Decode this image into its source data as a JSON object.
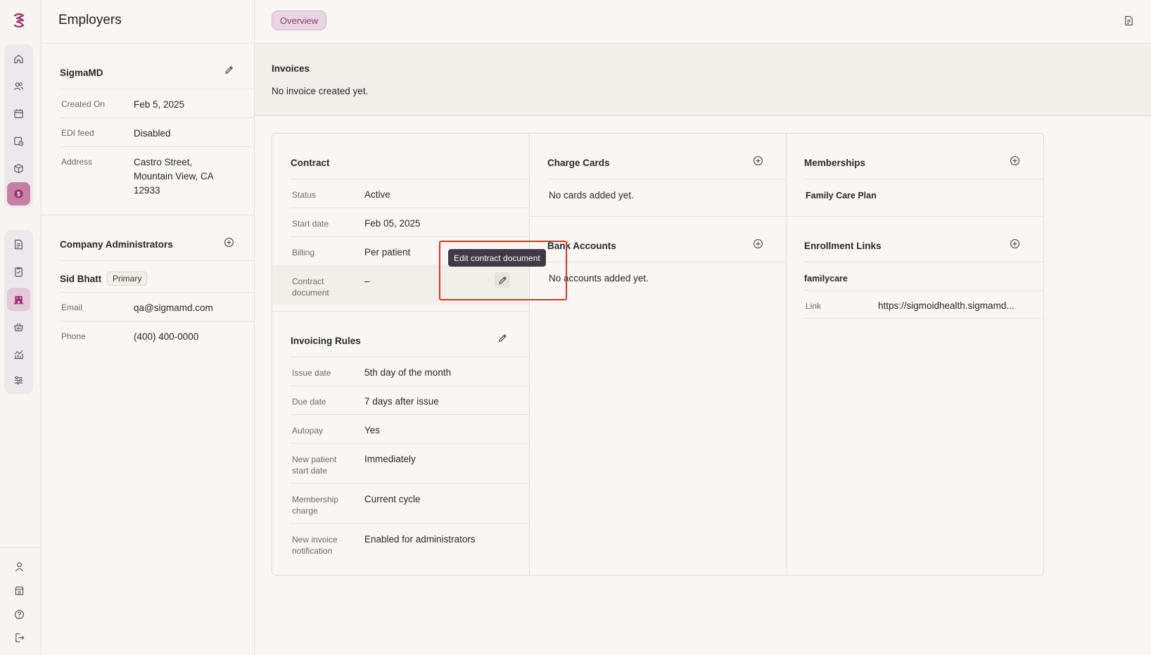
{
  "app": {
    "page_title": "Employers"
  },
  "nav": {
    "top_icons": [
      "home-icon",
      "patients-icon",
      "calendar-icon",
      "tasks-icon",
      "inventory-icon",
      "billing-icon"
    ],
    "secondary_icons": [
      "documents-icon",
      "reports-icon",
      "employers-icon",
      "store-icon",
      "analytics-icon",
      "settings-icon"
    ],
    "bottom_icons": [
      "profile-icon",
      "clinic-icon",
      "help-icon",
      "logout-icon"
    ]
  },
  "employer": {
    "name": "SigmaMD",
    "created_on_label": "Created On",
    "created_on": "Feb 5, 2025",
    "edi_label": "EDI feed",
    "edi_value": "Disabled",
    "address_label": "Address",
    "address_line1": "Castro Street,",
    "address_line2": "Mountain View, CA",
    "address_line3": "12933"
  },
  "administrators": {
    "title": "Company Administrators",
    "name": "Sid Bhatt",
    "badge": "Primary",
    "email_label": "Email",
    "email": "qa@sigmamd.com",
    "phone_label": "Phone",
    "phone": "(400) 400-0000"
  },
  "tabs": {
    "overview": "Overview"
  },
  "invoices": {
    "title": "Invoices",
    "empty": "No invoice created yet."
  },
  "contract": {
    "title": "Contract",
    "status_label": "Status",
    "status": "Active",
    "start_label": "Start date",
    "start": "Feb 05, 2025",
    "billing_label": "Billing",
    "billing": "Per patient",
    "doc_label_1": "Contract",
    "doc_label_2": "document",
    "doc": "–",
    "tooltip": "Edit contract document"
  },
  "invoicing_rules": {
    "title": "Invoicing Rules",
    "issue_label": "Issue date",
    "issue": "5th day of the month",
    "due_label": "Due date",
    "due": "7 days after issue",
    "autopay_label": "Autopay",
    "autopay": "Yes",
    "new_patient_label_1": "New patient",
    "new_patient_label_2": "start date",
    "new_patient": "Immediately",
    "membership_label_1": "Membership",
    "membership_label_2": "charge",
    "membership": "Current cycle",
    "notification_label_1": "New invoice",
    "notification_label_2": "notification",
    "notification": "Enabled for administrators"
  },
  "charge_cards": {
    "title": "Charge Cards",
    "empty": "No cards added yet."
  },
  "bank_accounts": {
    "title": "Bank Accounts",
    "empty": "No accounts added yet."
  },
  "memberships": {
    "title": "Memberships",
    "plan": "Family Care Plan"
  },
  "enrollment": {
    "title": "Enrollment Links",
    "name": "familycare",
    "link_label": "Link",
    "link": "https://sigmoidhealth.sigmamd..."
  },
  "colors": {
    "accent": "#8b3d67",
    "accent_bg": "#ead5e2",
    "highlight": "#e0322b",
    "tooltip_bg": "#3f3a45"
  }
}
